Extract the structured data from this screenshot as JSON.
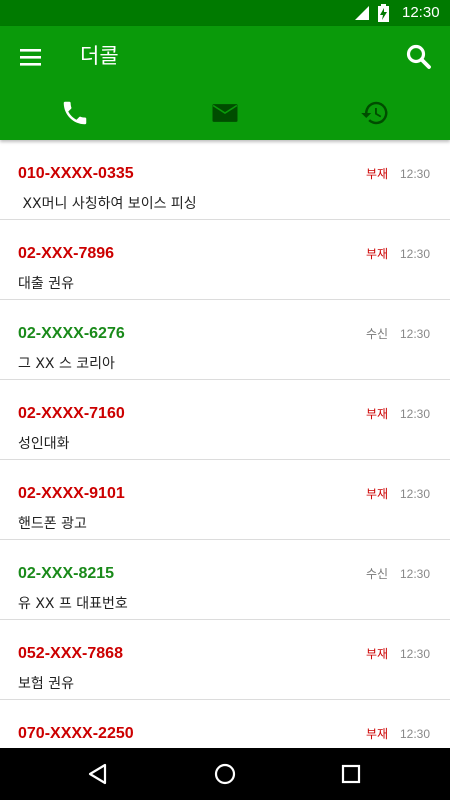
{
  "status_bar": {
    "time": "12:30"
  },
  "app_bar": {
    "title": "더콜",
    "menu_icon": "hamburger-menu-icon",
    "search_icon": "search-icon"
  },
  "tabs": [
    {
      "icon": "phone-icon",
      "active": true
    },
    {
      "icon": "envelope-icon",
      "active": false
    },
    {
      "icon": "history-icon",
      "active": false
    }
  ],
  "colors": {
    "primary": "#0a9a0a",
    "primary_dark": "#007a00",
    "tab_inactive": "#004d00",
    "missed": "#cc0000",
    "received": "#1a8a1a",
    "status_received": "#777777"
  },
  "calls": [
    {
      "number": "010-XXXX-0335",
      "status": "부재",
      "time": "12:30",
      "description": " XX머니 사칭하여 보이스 피싱",
      "type": "missed"
    },
    {
      "number": "02-XXX-7896",
      "status": "부재",
      "time": "12:30",
      "description": "대출 권유",
      "type": "missed"
    },
    {
      "number": "02-XXXX-6276",
      "status": "수신",
      "time": "12:30",
      "description": "그 XX 스 코리아",
      "type": "received"
    },
    {
      "number": "02-XXXX-7160",
      "status": "부재",
      "time": "12:30",
      "description": "성인대화",
      "type": "missed"
    },
    {
      "number": "02-XXXX-9101",
      "status": "부재",
      "time": "12:30",
      "description": "핸드폰 광고",
      "type": "missed"
    },
    {
      "number": "02-XXX-8215",
      "status": "수신",
      "time": "12:30",
      "description": "유 XX 프 대표번호",
      "type": "received"
    },
    {
      "number": "052-XXX-7868",
      "status": "부재",
      "time": "12:30",
      "description": "보험 권유",
      "type": "missed"
    },
    {
      "number": "070-XXXX-2250",
      "status": "부재",
      "time": "12:30",
      "description": "",
      "type": "missed"
    }
  ],
  "nav_bar": {
    "back_icon": "back-icon",
    "home_icon": "home-icon",
    "recents_icon": "recents-icon"
  }
}
